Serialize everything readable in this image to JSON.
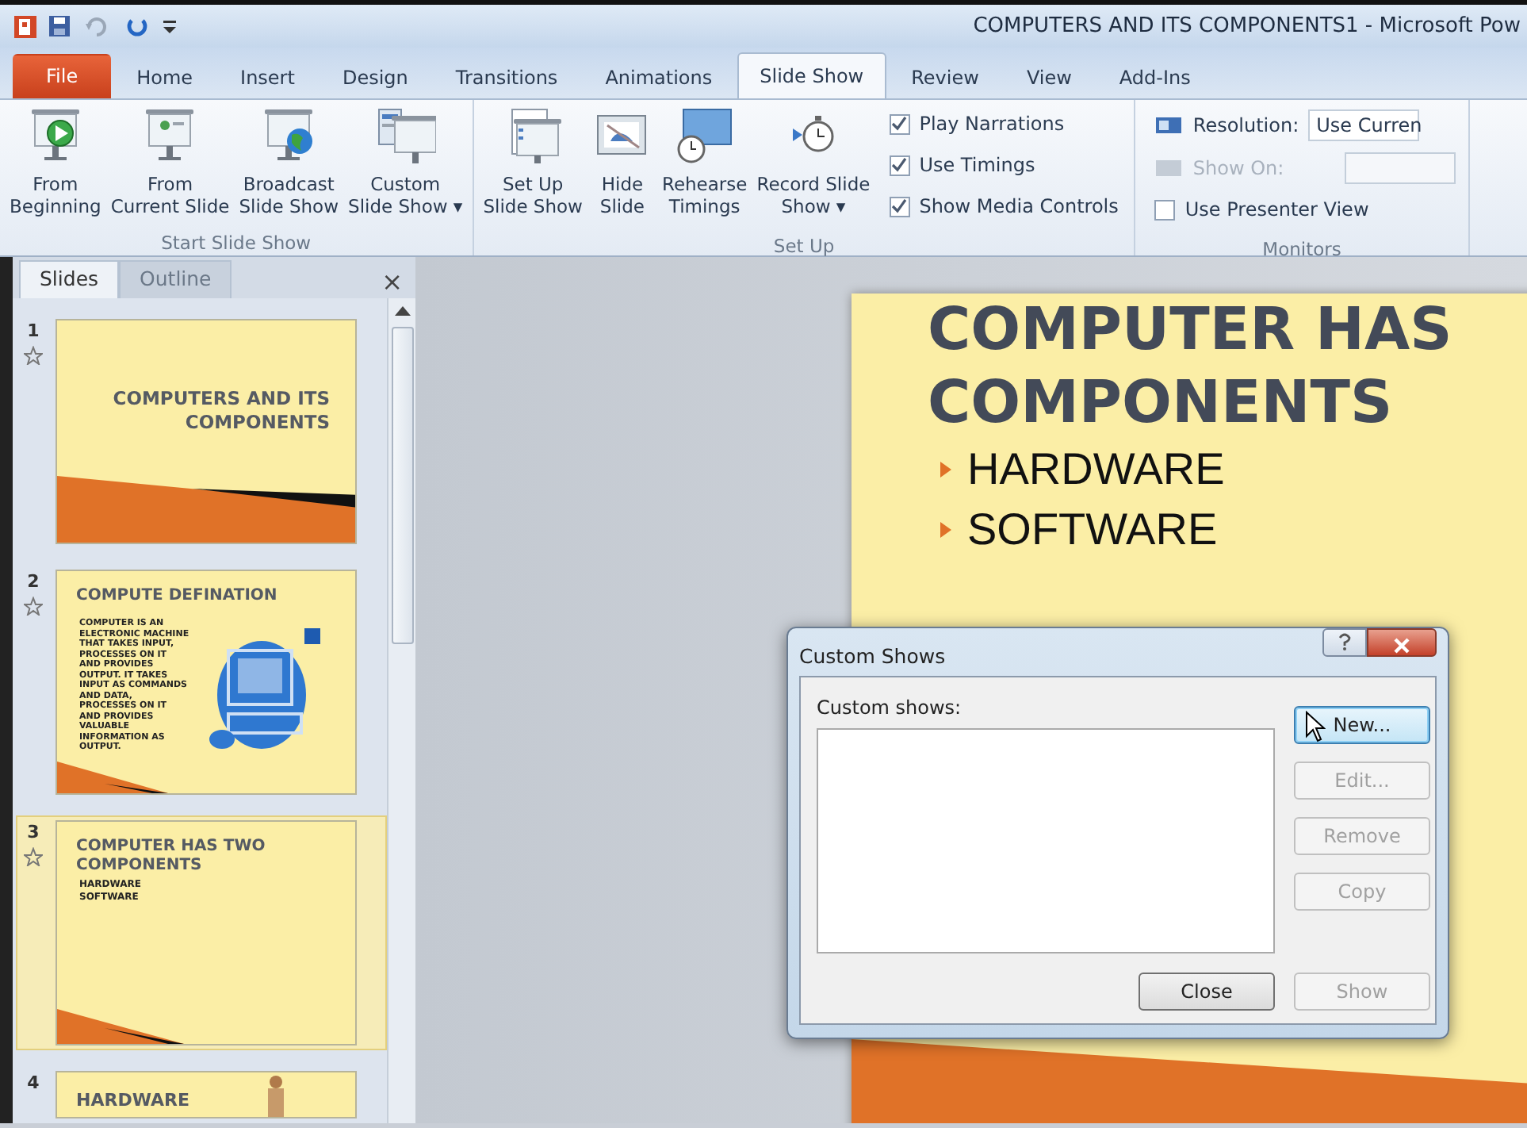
{
  "window": {
    "title": "COMPUTERS AND ITS COMPONENTS1  -  Microsoft Pow"
  },
  "tabs": [
    {
      "label": "File",
      "kind": "file",
      "selected": false
    },
    {
      "label": "Home",
      "kind": "tab",
      "selected": false
    },
    {
      "label": "Insert",
      "kind": "tab",
      "selected": false
    },
    {
      "label": "Design",
      "kind": "tab",
      "selected": false
    },
    {
      "label": "Transitions",
      "kind": "tab",
      "selected": false
    },
    {
      "label": "Animations",
      "kind": "tab",
      "selected": false
    },
    {
      "label": "Slide Show",
      "kind": "tab",
      "selected": true
    },
    {
      "label": "Review",
      "kind": "tab",
      "selected": false
    },
    {
      "label": "View",
      "kind": "tab",
      "selected": false
    },
    {
      "label": "Add-Ins",
      "kind": "tab",
      "selected": false
    }
  ],
  "ribbon": {
    "groups": [
      {
        "label": "Start Slide Show",
        "items": [
          {
            "kind": "big",
            "lines": [
              "From",
              "Beginning"
            ]
          },
          {
            "kind": "big",
            "lines": [
              "From",
              "Current Slide"
            ]
          },
          {
            "kind": "big",
            "lines": [
              "Broadcast",
              "Slide Show"
            ]
          },
          {
            "kind": "big",
            "lines": [
              "Custom",
              "Slide Show ▾"
            ]
          }
        ]
      },
      {
        "label": "Set Up",
        "items": [
          {
            "kind": "big",
            "lines": [
              "Set Up",
              "Slide Show"
            ]
          },
          {
            "kind": "big",
            "lines": [
              "Hide",
              "Slide"
            ]
          },
          {
            "kind": "big",
            "lines": [
              "Rehearse",
              "Timings"
            ]
          },
          {
            "kind": "big",
            "lines": [
              "Record Slide",
              "Show ▾"
            ]
          },
          {
            "kind": "checks",
            "checks": [
              {
                "label": "Play Narrations",
                "checked": true
              },
              {
                "label": "Use Timings",
                "checked": true
              },
              {
                "label": "Show Media Controls",
                "checked": true
              }
            ]
          }
        ]
      },
      {
        "label": "Monitors",
        "items": [
          {
            "kind": "monitors",
            "resolution_label": "Resolution:",
            "resolution_value": "Use Curren",
            "show_on_label": "Show On:",
            "show_on_disabled": true,
            "presenter": {
              "label": "Use Presenter View",
              "checked": false
            }
          }
        ]
      }
    ]
  },
  "pane": {
    "tabs": [
      {
        "label": "Slides",
        "selected": true
      },
      {
        "label": "Outline",
        "selected": false
      }
    ],
    "close": "×",
    "slides": [
      {
        "number": "1",
        "selected": false,
        "kind": "title",
        "title": "COMPUTERS AND ITS COMPONENTS"
      },
      {
        "number": "2",
        "selected": false,
        "kind": "content_image",
        "title": "COMPUTE  DEFINATION",
        "body": "COMPUTER IS AN ELECTRONIC MACHINE THAT TAKES INPUT, PROCESSES ON IT AND PROVIDES OUTPUT. IT TAKES INPUT AS COMMANDS AND DATA, PROCESSES ON IT AND PROVIDES VALUABLE INFORMATION AS OUTPUT."
      },
      {
        "number": "3",
        "selected": true,
        "kind": "bullets",
        "title": "COMPUTER HAS TWO COMPONENTS",
        "bullets": [
          "HARDWARE",
          "SOFTWARE"
        ]
      },
      {
        "number": "4",
        "selected": false,
        "kind": "picture",
        "title": "HARDWARE"
      }
    ]
  },
  "slide": {
    "title_lines": [
      "COMPUTER HAS",
      "COMPONENTS"
    ],
    "bullets": [
      "HARDWARE",
      "SOFTWARE"
    ]
  },
  "dialog": {
    "title": "Custom Shows",
    "list_label": "Custom shows:",
    "side_buttons": [
      {
        "label": "New...",
        "disabled": false,
        "focused": true
      },
      {
        "label": "Edit...",
        "disabled": true,
        "focused": false
      },
      {
        "label": "Remove",
        "disabled": true,
        "focused": false
      },
      {
        "label": "Copy",
        "disabled": true,
        "focused": false
      }
    ],
    "bottom_buttons": [
      {
        "label": "Close",
        "disabled": false
      },
      {
        "label": "Show",
        "disabled": true
      }
    ]
  }
}
